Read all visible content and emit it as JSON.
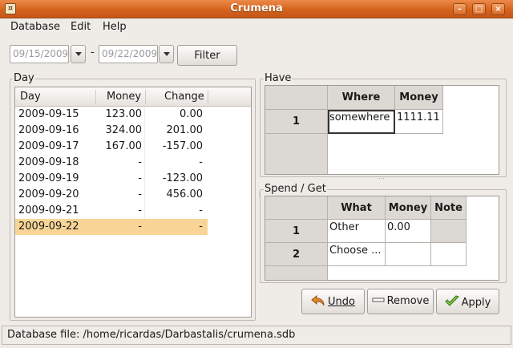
{
  "window": {
    "title": "Crumena"
  },
  "menu": [
    "Database",
    "Edit",
    "Help"
  ],
  "filter": {
    "date_from": "09/15/2009",
    "date_to": "09/22/2009",
    "separator": "-",
    "filter_label": "Filter"
  },
  "day_panel": {
    "label": "Day",
    "columns": [
      "Day",
      "Money",
      "Change"
    ],
    "rows": [
      {
        "day": "2009-09-15",
        "money": "123.00",
        "change": "0.00"
      },
      {
        "day": "2009-09-16",
        "money": "324.00",
        "change": "201.00"
      },
      {
        "day": "2009-09-17",
        "money": "167.00",
        "change": "-157.00"
      },
      {
        "day": "2009-09-18",
        "money": "-",
        "change": "-"
      },
      {
        "day": "2009-09-19",
        "money": "-",
        "change": "-123.00"
      },
      {
        "day": "2009-09-20",
        "money": "-",
        "change": "456.00"
      },
      {
        "day": "2009-09-21",
        "money": "-",
        "change": "-"
      },
      {
        "day": "2009-09-22",
        "money": "-",
        "change": "-"
      }
    ],
    "selected_row": 7
  },
  "have_panel": {
    "label": "Have",
    "columns": [
      "Where",
      "Money"
    ],
    "rows": [
      {
        "num": "1",
        "where": "somewhere",
        "money": "1111.11"
      }
    ]
  },
  "spend_panel": {
    "label": "Spend / Get",
    "columns": [
      "What",
      "Money",
      "Note"
    ],
    "rows": [
      {
        "num": "1",
        "what": "Other",
        "money": "0.00",
        "note": ""
      },
      {
        "num": "2",
        "what": "Choose ...",
        "money": "",
        "note": ""
      }
    ]
  },
  "actions": {
    "undo": "Undo",
    "remove": "Remove",
    "apply": "Apply"
  },
  "status": {
    "text": "Database file: /home/ricardas/Darbastalis/crumena.sdb"
  },
  "colors": {
    "title_bar": "#d5631b",
    "selection": "#f8d596",
    "grid_header": "#dcd8d3"
  }
}
